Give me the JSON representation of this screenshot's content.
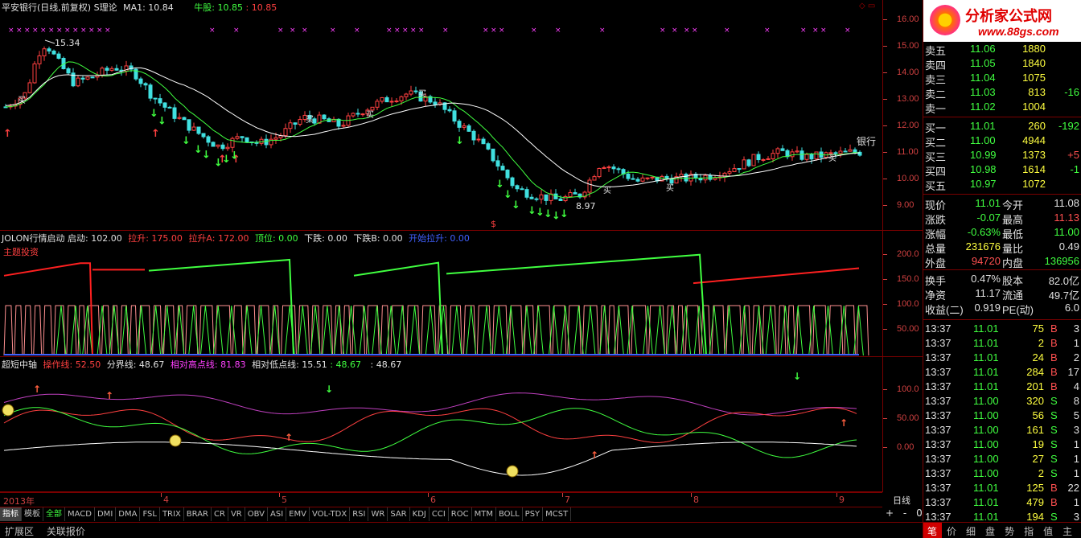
{
  "header": {
    "name": "平安银行(日线,前复权)",
    "theory": "S理论",
    "ma_label": "MA1: 10.84",
    "bull_label": "牛股: 10.85",
    "bull_val": ": 10.85"
  },
  "main_axis": [
    "16.00",
    "15.00",
    "14.00",
    "13.00",
    "12.00",
    "11.00",
    "10.00",
    "9.00"
  ],
  "main_labels": {
    "high": "15.34",
    "low": "8.97",
    "bank": "银行",
    "buy": "买",
    "sell_mark": "$"
  },
  "ind1": {
    "title": "JOLON行情启动",
    "start": "启动: 102.00",
    "rise": "拉升: 175.00",
    "riseA": "拉升A: 172.00",
    "top": "顶位: 0.00",
    "fall": "下跌: 0.00",
    "fallB": "下跌B: 0.00",
    "startRise": "开始拉升: 0.00",
    "overlay": "主题投资",
    "axis": [
      "200.0",
      "150.0",
      "100.0",
      "50.00"
    ]
  },
  "ind2": {
    "title": "超短中轴",
    "op": "操作线: 52.50",
    "div": "分界线: 48.67",
    "hi": "相对高点线: 81.83",
    "lo": "相对低点线: 15.51",
    "v1": ": 48.67",
    "v2": ": 48.67",
    "axis": [
      "100.0",
      "50.00",
      "0.00"
    ]
  },
  "time_axis": {
    "year": "2013年",
    "months": [
      "4",
      "5",
      "6",
      "7",
      "8",
      "9"
    ],
    "period": "日线"
  },
  "tabs": [
    "指标",
    "模板",
    "全部",
    "MACD",
    "DMI",
    "DMA",
    "FSL",
    "TRIX",
    "BRAR",
    "CR",
    "VR",
    "OBV",
    "ASI",
    "EMV",
    "VOL-TDX",
    "RSI",
    "WR",
    "SAR",
    "KDJ",
    "CCI",
    "ROC",
    "MTM",
    "BOLL",
    "PSY",
    "MCST"
  ],
  "zoom": {
    "plus": "+",
    "minus": "-",
    "zero": "0"
  },
  "bottom_left": [
    "扩展区",
    "关联报价"
  ],
  "brand": {
    "name": "分析家公式网",
    "url": "www.88gs.com"
  },
  "sells": [
    {
      "label": "卖五",
      "price": "11.06",
      "vol": "1880",
      "chg": ""
    },
    {
      "label": "卖四",
      "price": "11.05",
      "vol": "1840",
      "chg": ""
    },
    {
      "label": "卖三",
      "price": "11.04",
      "vol": "1075",
      "chg": ""
    },
    {
      "label": "卖二",
      "price": "11.03",
      "vol": "813",
      "chg": "-16"
    },
    {
      "label": "卖一",
      "price": "11.02",
      "vol": "1004",
      "chg": ""
    }
  ],
  "buys": [
    {
      "label": "买一",
      "price": "11.01",
      "vol": "260",
      "chg": "-192"
    },
    {
      "label": "买二",
      "price": "11.00",
      "vol": "4944",
      "chg": ""
    },
    {
      "label": "买三",
      "price": "10.99",
      "vol": "1373",
      "chg": "+5"
    },
    {
      "label": "买四",
      "price": "10.98",
      "vol": "1614",
      "chg": "-1"
    },
    {
      "label": "买五",
      "price": "10.97",
      "vol": "1072",
      "chg": ""
    }
  ],
  "quote": [
    [
      "现价",
      "11.01",
      "今开",
      "11.08"
    ],
    [
      "涨跌",
      "-0.07",
      "最高",
      "11.13"
    ],
    [
      "涨幅",
      "-0.63%",
      "最低",
      "11.00"
    ],
    [
      "总量",
      "231676",
      "量比",
      "0.49"
    ],
    [
      "外盘",
      "94720",
      "内盘",
      "136956"
    ]
  ],
  "quote2": [
    [
      "换手",
      "0.47%",
      "股本",
      "82.0亿"
    ],
    [
      "净资",
      "11.17",
      "流通",
      "49.7亿"
    ],
    [
      "收益(二)",
      "0.919",
      "PE(动)",
      "6.0"
    ]
  ],
  "ticks": [
    [
      "13:37",
      "11.01",
      "75",
      "B",
      "3"
    ],
    [
      "13:37",
      "11.01",
      "2",
      "B",
      "1"
    ],
    [
      "13:37",
      "11.01",
      "24",
      "B",
      "2"
    ],
    [
      "13:37",
      "11.01",
      "284",
      "B",
      "17"
    ],
    [
      "13:37",
      "11.01",
      "201",
      "B",
      "4"
    ],
    [
      "13:37",
      "11.00",
      "320",
      "S",
      "8"
    ],
    [
      "13:37",
      "11.00",
      "56",
      "S",
      "5"
    ],
    [
      "13:37",
      "11.00",
      "161",
      "S",
      "3"
    ],
    [
      "13:37",
      "11.00",
      "19",
      "S",
      "1"
    ],
    [
      "13:37",
      "11.00",
      "27",
      "S",
      "1"
    ],
    [
      "13:37",
      "11.00",
      "2",
      "S",
      "1"
    ],
    [
      "13:37",
      "11.01",
      "125",
      "B",
      "22"
    ],
    [
      "13:37",
      "11.01",
      "479",
      "B",
      "1"
    ],
    [
      "13:37",
      "11.01",
      "194",
      "S",
      "3"
    ]
  ],
  "bottom_tabs": [
    "笔",
    "价",
    "细",
    "盘",
    "势",
    "指",
    "值",
    "主"
  ],
  "colors": {
    "up": "#ff4040",
    "down": "#40e0e0",
    "ma": "#ffffff",
    "bull": "#40ff40",
    "frame": "#7a0000"
  }
}
